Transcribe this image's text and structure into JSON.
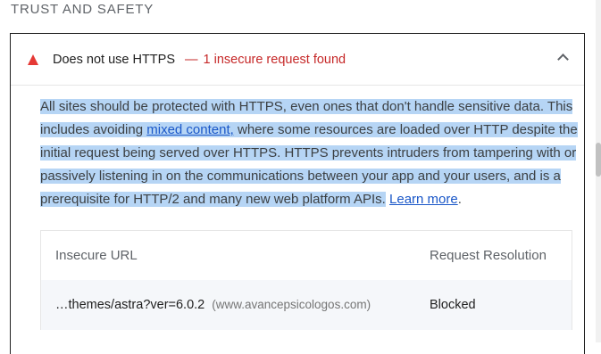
{
  "section": {
    "title": "TRUST AND SAFETY"
  },
  "audit": {
    "title": "Does not use HTTPS",
    "separator": "—",
    "display_value": "1 insecure request found",
    "status_icon": "fail-triangle-icon",
    "expand_icon": "chevron-up-icon",
    "status_color": "#e53935",
    "description": {
      "p1": "All sites should be protected with HTTPS, even ones that don't handle sensitive data. This includes avoiding ",
      "link1": "mixed content,",
      "p2": " where some resources are loaded over HTTP despite the initial request being served over HTTPS. HTTPS prevents intruders from tampering with or passively listening in on the communications between your app and your users, and is a prerequisite for HTTP/2 and many new web platform APIs.",
      "space": " ",
      "link2": "Learn more",
      "end": "."
    }
  },
  "table": {
    "headers": {
      "url": "Insecure URL",
      "resolution": "Request Resolution"
    },
    "rows": [
      {
        "url": "…themes/astra?ver=6.0.2",
        "host": "(www.avancepsicologos.com)",
        "resolution": "Blocked"
      }
    ]
  },
  "colors": {
    "highlight": "#b6d5f5",
    "link": "#1a57c8",
    "fail": "#c62828"
  }
}
